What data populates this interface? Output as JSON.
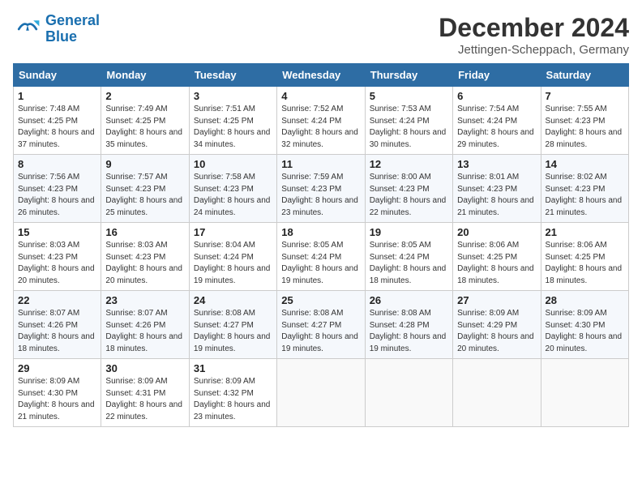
{
  "header": {
    "logo_text_general": "General",
    "logo_text_blue": "Blue",
    "month_title": "December 2024",
    "location": "Jettingen-Scheppach, Germany"
  },
  "weekdays": [
    "Sunday",
    "Monday",
    "Tuesday",
    "Wednesday",
    "Thursday",
    "Friday",
    "Saturday"
  ],
  "weeks": [
    [
      {
        "day": "1",
        "sunrise": "7:48 AM",
        "sunset": "4:25 PM",
        "daylight": "8 hours and 37 minutes."
      },
      {
        "day": "2",
        "sunrise": "7:49 AM",
        "sunset": "4:25 PM",
        "daylight": "8 hours and 35 minutes."
      },
      {
        "day": "3",
        "sunrise": "7:51 AM",
        "sunset": "4:25 PM",
        "daylight": "8 hours and 34 minutes."
      },
      {
        "day": "4",
        "sunrise": "7:52 AM",
        "sunset": "4:24 PM",
        "daylight": "8 hours and 32 minutes."
      },
      {
        "day": "5",
        "sunrise": "7:53 AM",
        "sunset": "4:24 PM",
        "daylight": "8 hours and 30 minutes."
      },
      {
        "day": "6",
        "sunrise": "7:54 AM",
        "sunset": "4:24 PM",
        "daylight": "8 hours and 29 minutes."
      },
      {
        "day": "7",
        "sunrise": "7:55 AM",
        "sunset": "4:23 PM",
        "daylight": "8 hours and 28 minutes."
      }
    ],
    [
      {
        "day": "8",
        "sunrise": "7:56 AM",
        "sunset": "4:23 PM",
        "daylight": "8 hours and 26 minutes."
      },
      {
        "day": "9",
        "sunrise": "7:57 AM",
        "sunset": "4:23 PM",
        "daylight": "8 hours and 25 minutes."
      },
      {
        "day": "10",
        "sunrise": "7:58 AM",
        "sunset": "4:23 PM",
        "daylight": "8 hours and 24 minutes."
      },
      {
        "day": "11",
        "sunrise": "7:59 AM",
        "sunset": "4:23 PM",
        "daylight": "8 hours and 23 minutes."
      },
      {
        "day": "12",
        "sunrise": "8:00 AM",
        "sunset": "4:23 PM",
        "daylight": "8 hours and 22 minutes."
      },
      {
        "day": "13",
        "sunrise": "8:01 AM",
        "sunset": "4:23 PM",
        "daylight": "8 hours and 21 minutes."
      },
      {
        "day": "14",
        "sunrise": "8:02 AM",
        "sunset": "4:23 PM",
        "daylight": "8 hours and 21 minutes."
      }
    ],
    [
      {
        "day": "15",
        "sunrise": "8:03 AM",
        "sunset": "4:23 PM",
        "daylight": "8 hours and 20 minutes."
      },
      {
        "day": "16",
        "sunrise": "8:03 AM",
        "sunset": "4:23 PM",
        "daylight": "8 hours and 20 minutes."
      },
      {
        "day": "17",
        "sunrise": "8:04 AM",
        "sunset": "4:24 PM",
        "daylight": "8 hours and 19 minutes."
      },
      {
        "day": "18",
        "sunrise": "8:05 AM",
        "sunset": "4:24 PM",
        "daylight": "8 hours and 19 minutes."
      },
      {
        "day": "19",
        "sunrise": "8:05 AM",
        "sunset": "4:24 PM",
        "daylight": "8 hours and 18 minutes."
      },
      {
        "day": "20",
        "sunrise": "8:06 AM",
        "sunset": "4:25 PM",
        "daylight": "8 hours and 18 minutes."
      },
      {
        "day": "21",
        "sunrise": "8:06 AM",
        "sunset": "4:25 PM",
        "daylight": "8 hours and 18 minutes."
      }
    ],
    [
      {
        "day": "22",
        "sunrise": "8:07 AM",
        "sunset": "4:26 PM",
        "daylight": "8 hours and 18 minutes."
      },
      {
        "day": "23",
        "sunrise": "8:07 AM",
        "sunset": "4:26 PM",
        "daylight": "8 hours and 18 minutes."
      },
      {
        "day": "24",
        "sunrise": "8:08 AM",
        "sunset": "4:27 PM",
        "daylight": "8 hours and 19 minutes."
      },
      {
        "day": "25",
        "sunrise": "8:08 AM",
        "sunset": "4:27 PM",
        "daylight": "8 hours and 19 minutes."
      },
      {
        "day": "26",
        "sunrise": "8:08 AM",
        "sunset": "4:28 PM",
        "daylight": "8 hours and 19 minutes."
      },
      {
        "day": "27",
        "sunrise": "8:09 AM",
        "sunset": "4:29 PM",
        "daylight": "8 hours and 20 minutes."
      },
      {
        "day": "28",
        "sunrise": "8:09 AM",
        "sunset": "4:30 PM",
        "daylight": "8 hours and 20 minutes."
      }
    ],
    [
      {
        "day": "29",
        "sunrise": "8:09 AM",
        "sunset": "4:30 PM",
        "daylight": "8 hours and 21 minutes."
      },
      {
        "day": "30",
        "sunrise": "8:09 AM",
        "sunset": "4:31 PM",
        "daylight": "8 hours and 22 minutes."
      },
      {
        "day": "31",
        "sunrise": "8:09 AM",
        "sunset": "4:32 PM",
        "daylight": "8 hours and 23 minutes."
      },
      null,
      null,
      null,
      null
    ]
  ],
  "labels": {
    "sunrise": "Sunrise:",
    "sunset": "Sunset:",
    "daylight": "Daylight:"
  }
}
